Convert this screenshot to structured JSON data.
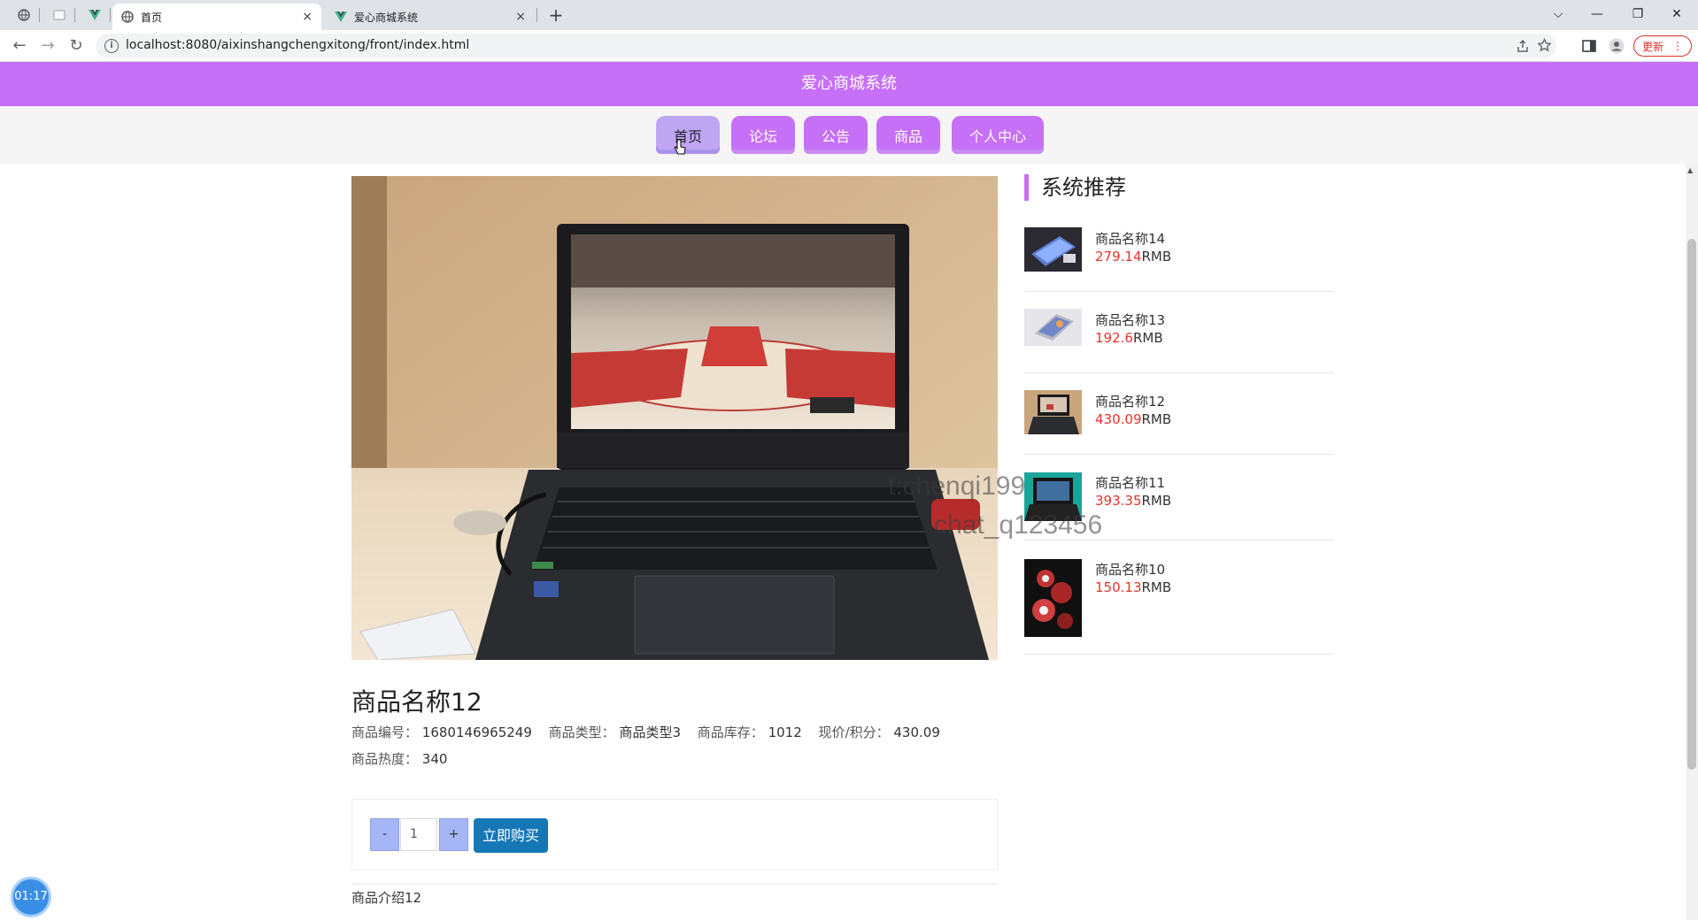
{
  "browser": {
    "tabs": [
      {
        "title": "首页",
        "close": "×"
      },
      {
        "title": "爱心商城系统",
        "close": "×"
      }
    ],
    "new_tab": "+",
    "window_controls": {
      "menu": "⌵",
      "minimize": "—",
      "restore": "❐",
      "close": "✕"
    },
    "nav": {
      "back": "←",
      "forward": "→",
      "reload": "↻"
    },
    "url": "localhost:8080/aixinshangchengxitong/front/index.html",
    "update_label": "更新",
    "update_menu": "⋮"
  },
  "site": {
    "title": "爱心商城系统",
    "nav": [
      "首页",
      "论坛",
      "公告",
      "商品",
      "个人中心"
    ],
    "active_nav": "首页"
  },
  "product": {
    "name": "商品名称12",
    "fields": {
      "code_label": "商品编号：",
      "code": "1680146965249",
      "type_label": "商品类型：",
      "type": "商品类型3",
      "stock_label": "商品库存：",
      "stock": "1012",
      "price_label": "现价/积分：",
      "price": "430.09",
      "heat_label": "商品热度：",
      "heat": "340"
    },
    "quantity": "1",
    "minus": "-",
    "plus": "+",
    "buy_label": "立即购买",
    "intro": "商品介绍12"
  },
  "recommend": {
    "title": "系统推荐",
    "currency": "RMB",
    "items": [
      {
        "name": "商品名称14",
        "price": "279.14"
      },
      {
        "name": "商品名称13",
        "price": "192.6"
      },
      {
        "name": "商品名称12",
        "price": "430.09"
      },
      {
        "name": "商品名称11",
        "price": "393.35"
      },
      {
        "name": "商品名称10",
        "price": "150.13"
      }
    ]
  },
  "watermark": {
    "line1": "t:chenqi199",
    "line2": "chat_q123456"
  },
  "timer": "01:17",
  "colors": {
    "brand": "#c66ff7",
    "price": "#e8322c",
    "buy": "#1677b7"
  }
}
